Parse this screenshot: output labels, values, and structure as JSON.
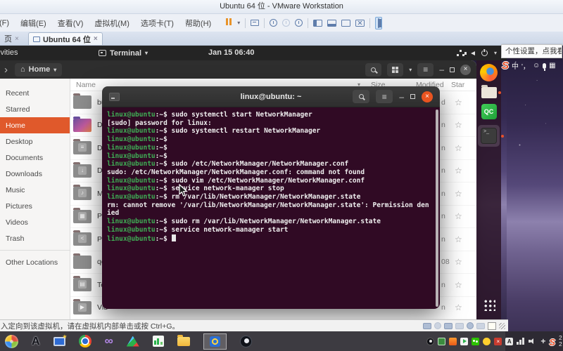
{
  "icons": {
    "close": "×",
    "caret": "▾",
    "hamburger": "≡",
    "minimize": "–",
    "star": "☆",
    "forward": "›",
    "back": "‹",
    "home": "⌂",
    "infinity": "∞",
    "emblem_documents": "≡",
    "emblem_downloads": "↓",
    "emblem_music": "♪",
    "emblem_pictures": "▦",
    "emblem_public": "<",
    "emblem_templates": "▤",
    "emblem_videos": "▶",
    "letter_a": "A",
    "smiley": "☺",
    "keyboard": "▦",
    "move": "+",
    "sogou_s": "S",
    "qc_label": "QC"
  },
  "vmware": {
    "title": "Ubuntu 64 位 - VMware Workstation",
    "menus": [
      "(F)",
      "编辑(E)",
      "查看(V)",
      "虚拟机(M)",
      "选项卡(T)",
      "帮助(H)"
    ],
    "tab_partial": "页",
    "tab_active": "Ubuntu 64 位",
    "status_message": "入定向到该虚拟机，请在虚拟机内部单击或按 Ctrl+G。"
  },
  "host": {
    "tooltip": "个性设置，点我看看",
    "ime_mode": "中",
    "ime_punct": "'，",
    "tray_clock": "2 2"
  },
  "ubuntu": {
    "activities": "ivities",
    "focused_app": "Terminal",
    "clock": "Jan 15 06:40"
  },
  "files": {
    "path": "Home",
    "sidebar": [
      "Recent",
      "Starred",
      "Home",
      "Desktop",
      "Documents",
      "Downloads",
      "Music",
      "Pictures",
      "Videos",
      "Trash",
      "Other Locations"
    ],
    "selected": "Home",
    "columns": {
      "name": "Name",
      "size": "Size",
      "modified": "Modified",
      "star": "Star"
    },
    "rows": [
      {
        "name": "bui",
        "icon": "folder",
        "modified_partial": "d"
      },
      {
        "name": "Des",
        "icon": "desktop",
        "modified_partial": "n"
      },
      {
        "name": "Doc",
        "icon": "documents",
        "modified_partial": "n"
      },
      {
        "name": "Dow",
        "icon": "downloads",
        "modified_partial": "n"
      },
      {
        "name": "Mu",
        "icon": "music",
        "modified_partial": "n"
      },
      {
        "name": "Pic",
        "icon": "pictures",
        "modified_partial": "n"
      },
      {
        "name": "Pub",
        "icon": "public",
        "modified_partial": "n"
      },
      {
        "name": "qgr",
        "icon": "folder",
        "modified_partial": "08"
      },
      {
        "name": "Tem",
        "icon": "templates",
        "modified_partial": "n"
      },
      {
        "name": "Vid",
        "icon": "videos",
        "modified_partial": "n"
      }
    ]
  },
  "terminal": {
    "title": "linux@ubuntu: ~",
    "user": "linux@ubuntu",
    "sep": ":~$ ",
    "lines": [
      {
        "p": 1,
        "cmd": "sudo systemctl start NetworkManager"
      },
      {
        "p": 0,
        "cmd": "[sudo] password for linux: "
      },
      {
        "p": 1,
        "cmd": "sudo systemctl restart NetworkManager"
      },
      {
        "p": 1,
        "cmd": ""
      },
      {
        "p": 1,
        "cmd": ""
      },
      {
        "p": 1,
        "cmd": ""
      },
      {
        "p": 1,
        "cmd": "sudo /etc/NetworkManager/NetworkManager.conf"
      },
      {
        "p": 0,
        "cmd": "sudo: /etc/NetworkManager/NetworkManager.conf: command not found"
      },
      {
        "p": 1,
        "cmd": "sudo vim /etc/NetworkManager/NetworkManager.conf"
      },
      {
        "p": 1,
        "cmd": "service network-manager stop"
      },
      {
        "p": 1,
        "cmd": "rm /var/lib/NetworkManager/NetworkManager.state"
      },
      {
        "p": 0,
        "cmd": "rm: cannot remove '/var/lib/NetworkManager/NetworkManager.state': Permission den"
      },
      {
        "p": 0,
        "cmd": "ied"
      },
      {
        "p": 1,
        "cmd": "sudo rm /var/lib/NetworkManager/NetworkManager.state"
      },
      {
        "p": 1,
        "cmd": "service network-manager start"
      },
      {
        "p": 1,
        "cmd": "",
        "cursor": true
      }
    ]
  },
  "colors": {
    "ubuntu_orange": "#e0592b",
    "terminal_bg": "#300a24",
    "prompt_green": "#3fae55",
    "close_orange": "#e95420",
    "wallpaper_purple": "#554879"
  }
}
